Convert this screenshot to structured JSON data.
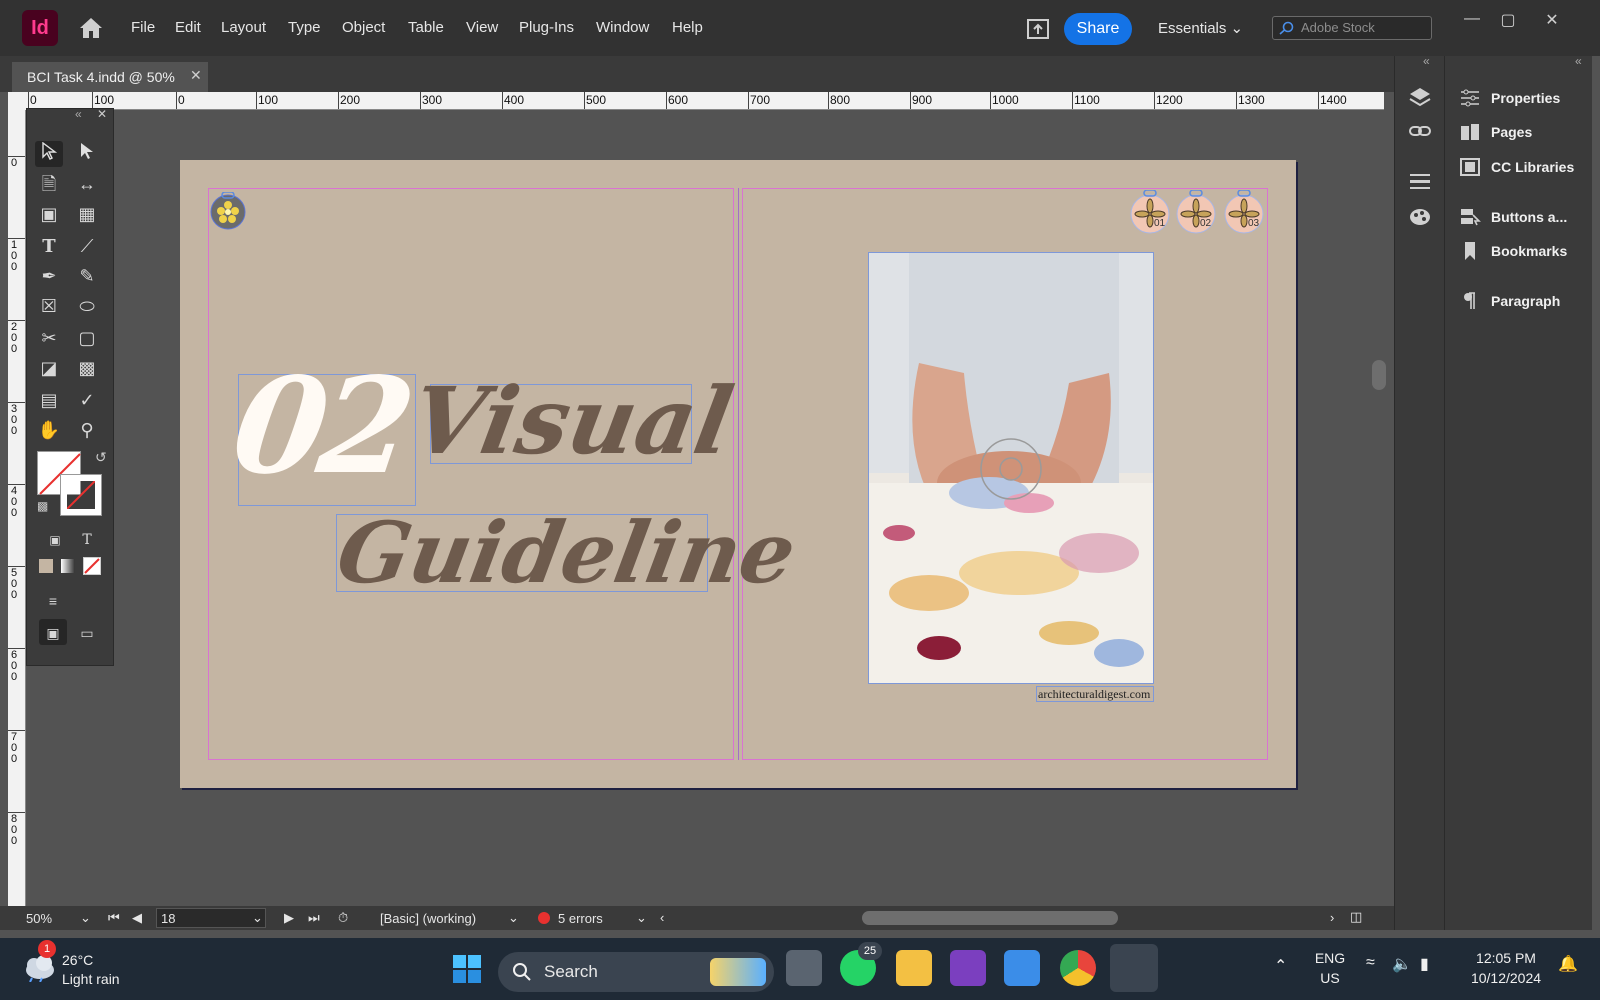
{
  "app": {
    "logo": "Id",
    "menu": [
      "File",
      "Edit",
      "Layout",
      "Type",
      "Object",
      "Table",
      "View",
      "Plug-Ins",
      "Window",
      "Help"
    ],
    "share_label": "Share",
    "workspace_label": "Essentials",
    "stock_placeholder": "Adobe Stock",
    "minimize": "—",
    "maximize": "▢",
    "close": "✕"
  },
  "document": {
    "tab_title": "BCI Task 4.indd @ 50%",
    "tab_close": "✕"
  },
  "rulers": {
    "horizontal_labels": [
      "0",
      "100",
      "0",
      "100",
      "200",
      "300",
      "400",
      "500",
      "600",
      "700",
      "800",
      "900",
      "1000",
      "1100",
      "1200",
      "1300",
      "1400"
    ],
    "vertical_labels": [
      "0",
      "100",
      "200",
      "300",
      "400",
      "500",
      "600",
      "700",
      "800"
    ]
  },
  "spread": {
    "headline_number": "02",
    "headline_word1": "Visual",
    "headline_word2": "Guideline",
    "caption": "architecturaldigest.com",
    "page_badges": [
      "01",
      "02",
      "03"
    ]
  },
  "right_panel": {
    "items": [
      "Properties",
      "Pages",
      "CC Libraries",
      "Buttons a...",
      "Bookmarks",
      "Paragraph"
    ]
  },
  "status": {
    "zoom": "50%",
    "page": "18",
    "profile": "[Basic] (working)",
    "errors": "5 errors"
  },
  "taskbar": {
    "weather_temp": "26°C",
    "weather_desc": "Light rain",
    "weather_badge": "1",
    "search_label": "Search",
    "whatsapp_badge": "25",
    "lang_1": "ENG",
    "lang_2": "US",
    "time": "12:05 PM",
    "date": "10/12/2024"
  },
  "colors": {
    "accent": "#1473e6",
    "page_bg": "#c4b5a3",
    "headline_brown": "#6e5b4d",
    "error_red": "#e8312f"
  }
}
